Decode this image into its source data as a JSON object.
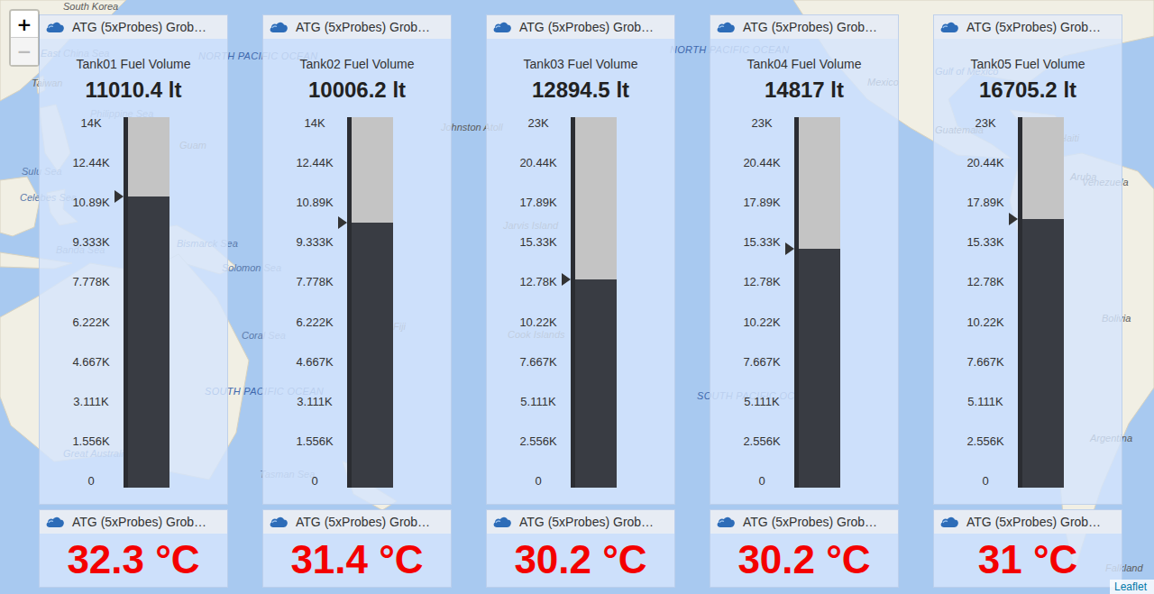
{
  "map": {
    "zoom": [
      {
        "label": "+",
        "disabled": false
      },
      {
        "label": "−",
        "disabled": true
      }
    ],
    "attribution": "Leaflet",
    "labels": [
      {
        "text": "South Korea",
        "kind": "place"
      },
      {
        "text": "East China Sea",
        "kind": "sea"
      },
      {
        "text": "NORTH PACIFIC OCEAN",
        "kind": "ocean"
      },
      {
        "text": "NORTH PACIFIC OCEAN",
        "kind": "ocean"
      },
      {
        "text": "Taiwan",
        "kind": "place"
      },
      {
        "text": "Philippine Sea",
        "kind": "sea"
      },
      {
        "text": "Guam",
        "kind": "place"
      },
      {
        "text": "Sulu Sea",
        "kind": "sea"
      },
      {
        "text": "Celebes Sea",
        "kind": "sea"
      },
      {
        "text": "Banda Sea",
        "kind": "sea"
      },
      {
        "text": "Bismarck Sea",
        "kind": "sea"
      },
      {
        "text": "Solomon Sea",
        "kind": "sea"
      },
      {
        "text": "Coral Sea",
        "kind": "sea"
      },
      {
        "text": "SOUTH PACIFIC OCEAN",
        "kind": "ocean"
      },
      {
        "text": "Great Australian Bight",
        "kind": "sea"
      },
      {
        "text": "Tasman Sea",
        "kind": "sea"
      },
      {
        "text": "Johnston Atoll",
        "kind": "place"
      },
      {
        "text": "Jarvis Island",
        "kind": "place"
      },
      {
        "text": "Cook Islands",
        "kind": "place"
      },
      {
        "text": "Fiji",
        "kind": "place"
      },
      {
        "text": "SOUTH PACIFIC OCEAN",
        "kind": "ocean"
      },
      {
        "text": "Mexico",
        "kind": "place"
      },
      {
        "text": "Gulf of Mexico",
        "kind": "sea"
      },
      {
        "text": "Guatemala",
        "kind": "place"
      },
      {
        "text": "Haiti",
        "kind": "place"
      },
      {
        "text": "Aruba",
        "kind": "place"
      },
      {
        "text": "Venezuela",
        "kind": "place"
      },
      {
        "text": "Bolivia",
        "kind": "place"
      },
      {
        "text": "Argentina",
        "kind": "place"
      },
      {
        "text": "Falkland",
        "kind": "place"
      }
    ]
  },
  "tanks": [
    {
      "header": "ATG (5xProbes) Grob…",
      "title": "Tank01 Fuel Volume",
      "reading": "11010.4 lt",
      "level": 0.786,
      "ticks": [
        "14K",
        "12.44K",
        "10.89K",
        "9.333K",
        "7.778K",
        "6.222K",
        "4.667K",
        "3.111K",
        "1.556K",
        "0"
      ],
      "temperature_header": "ATG (5xProbes) Grob…",
      "temperature": "32.3 °C"
    },
    {
      "header": "ATG (5xProbes) Grob…",
      "title": "Tank02 Fuel Volume",
      "reading": "10006.2 lt",
      "level": 0.715,
      "ticks": [
        "14K",
        "12.44K",
        "10.89K",
        "9.333K",
        "7.778K",
        "6.222K",
        "4.667K",
        "3.111K",
        "1.556K",
        "0"
      ],
      "temperature_header": "ATG (5xProbes) Grob…",
      "temperature": "31.4 °C"
    },
    {
      "header": "ATG (5xProbes) Grob…",
      "title": "Tank03 Fuel Volume",
      "reading": "12894.5 lt",
      "level": 0.561,
      "ticks": [
        "23K",
        "20.44K",
        "17.89K",
        "15.33K",
        "12.78K",
        "10.22K",
        "7.667K",
        "5.111K",
        "2.556K",
        "0"
      ],
      "temperature_header": "ATG (5xProbes) Grob…",
      "temperature": "30.2 °C"
    },
    {
      "header": "ATG (5xProbes) Grob…",
      "title": "Tank04 Fuel Volume",
      "reading": "14817 lt",
      "level": 0.644,
      "ticks": [
        "23K",
        "20.44K",
        "17.89K",
        "15.33K",
        "12.78K",
        "10.22K",
        "7.667K",
        "5.111K",
        "2.556K",
        "0"
      ],
      "temperature_header": "ATG (5xProbes) Grob…",
      "temperature": "30.2 °C"
    },
    {
      "header": "ATG (5xProbes) Grob…",
      "title": "Tank05 Fuel Volume",
      "reading": "16705.2 lt",
      "level": 0.726,
      "ticks": [
        "23K",
        "20.44K",
        "17.89K",
        "15.33K",
        "12.78K",
        "10.22K",
        "7.667K",
        "5.111K",
        "2.556K",
        "0"
      ],
      "temperature_header": "ATG (5xProbes) Grob…",
      "temperature": "31 °C"
    }
  ]
}
